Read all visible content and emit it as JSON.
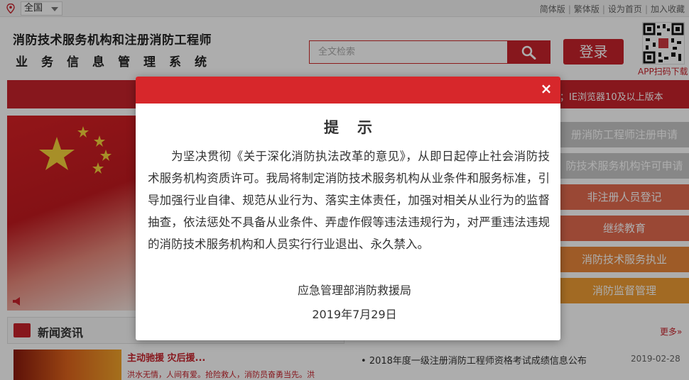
{
  "topbar": {
    "region": "全国",
    "links": [
      "简体版",
      "繁体版",
      "设为首页",
      "加入收藏"
    ]
  },
  "header": {
    "title_line1": "消防技术服务机构和注册消防工程师",
    "title_line2": "业务信息管理系统",
    "search_placeholder": "全文检索",
    "login_label": "登录",
    "qr_label": "APP扫码下载"
  },
  "banner": {
    "text": "；IE浏览器10及以上版本"
  },
  "menu": {
    "items": [
      {
        "label": "册消防工程师注册申请",
        "color": "#c8c8c8"
      },
      {
        "label": "防技术服务机构许可申请",
        "color": "#c8c8c8"
      },
      {
        "label": "非注册人员登记",
        "color": "#e46a4f"
      },
      {
        "label": "继续教育",
        "color": "#e46a4f"
      },
      {
        "label": "消防技术服务执业",
        "color": "#e9873a"
      },
      {
        "label": "消防监督管理",
        "color": "#ef9d34"
      }
    ]
  },
  "news": {
    "title": "新闻资讯",
    "more": "更多»",
    "featured_headline": "主动驰援 灾后援...",
    "featured_snippet": "洪水无情，人间有爱。抢险救人，消防员奋勇当先。洪",
    "items": [
      {
        "title": "2018年度一级注册消防工程师资格考试成绩信息公布",
        "date": "2019-02-28"
      }
    ]
  },
  "modal": {
    "title": "提示",
    "close": "×",
    "body": "为坚决贯彻《关于深化消防执法改革的意见》，从即日起停止社会消防技术服务机构资质许可。我局将制定消防技术服务机构从业条件和服务标准，引导加强行业自律、规范从业行为、落实主体责任，加强对相关从业行为的监督抽查，依法惩处不具备从业条件、弄虚作假等违法违规行为，对严重违法违规的消防技术服务机构和人员实行行业退出、永久禁入。",
    "org": "应急管理部消防救援局",
    "date": "2019年7月29日"
  },
  "colors": {
    "brand_red": "#c8222b",
    "modal_red": "#d7272b"
  }
}
